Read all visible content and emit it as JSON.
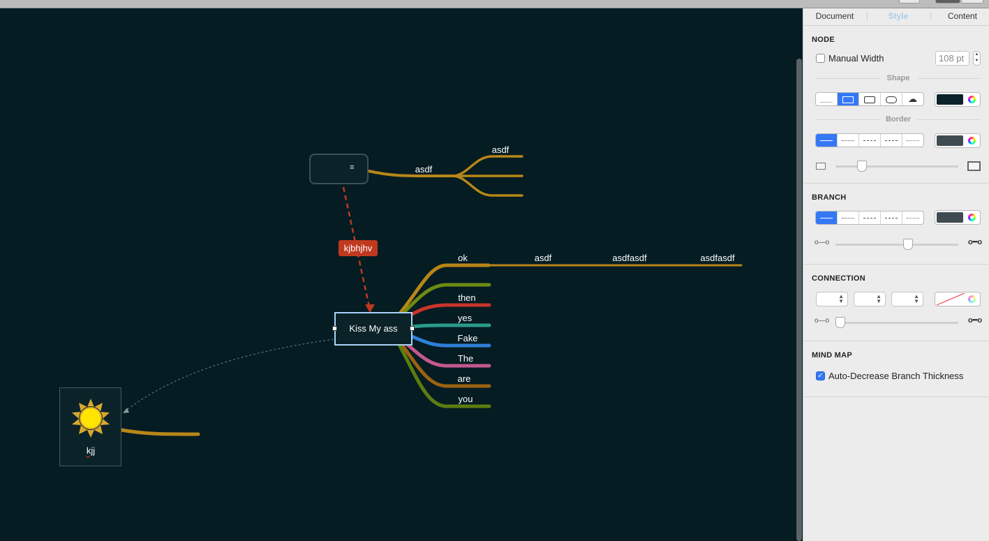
{
  "canvas": {
    "background": "#041c22",
    "nodes": {
      "upper_node_note_icon": "note-lines-icon",
      "central_topic": "Kiss My ass",
      "image_node_label": "kjj",
      "image_node_icon": "sun-icon"
    },
    "relationship_label": "kjbhjhv",
    "upper_branch_labels": [
      "asdf",
      "asdf"
    ],
    "main_branch_labels": [
      "ok",
      "then",
      "yes",
      "Fake",
      "The",
      "are",
      "you"
    ],
    "ok_chain_labels": [
      "asdf",
      "asdfasdf",
      "asdfasdf"
    ],
    "colors": {
      "branch_gold": "#b88618",
      "relationship_red": "#c0391f",
      "olive": "#6e8a12",
      "red": "#c9352a",
      "teal": "#2b9b8a",
      "blue": "#2f7fd8",
      "pink": "#c4588e",
      "brown": "#9b6210",
      "green": "#5c7d10"
    }
  },
  "inspector": {
    "tabs": [
      {
        "label": "Document",
        "active": false
      },
      {
        "label": "Style",
        "active": true
      },
      {
        "label": "Content",
        "active": false
      }
    ],
    "node": {
      "title": "NODE",
      "manual_width_label": "Manual Width",
      "manual_width_checked": false,
      "width_value": "108 pt",
      "shape_label": "Shape",
      "shape_options": [
        "none",
        "rectangle",
        "rounded-rectangle",
        "capsule",
        "cloud"
      ],
      "selected_shape": "rectangle",
      "fill_color": "#0b2229",
      "border_label": "Border",
      "border_styles": [
        "solid",
        "dotted",
        "dashed",
        "dash-dot",
        "fine-dotted"
      ],
      "selected_border": "solid",
      "border_color": "#3f4b50",
      "border_thickness": 0.12
    },
    "branch": {
      "title": "BRANCH",
      "styles": [
        "solid",
        "dotted",
        "dashed",
        "dash-dot",
        "fine-dotted"
      ],
      "selected": "solid",
      "color": "#3f4b50",
      "thickness": 0.59
    },
    "connection": {
      "title": "CONNECTION",
      "thickness": 0.03
    },
    "mind_map": {
      "title": "MIND MAP",
      "auto_decrease_label": "Auto-Decrease Branch Thickness",
      "auto_decrease_checked": true
    }
  }
}
